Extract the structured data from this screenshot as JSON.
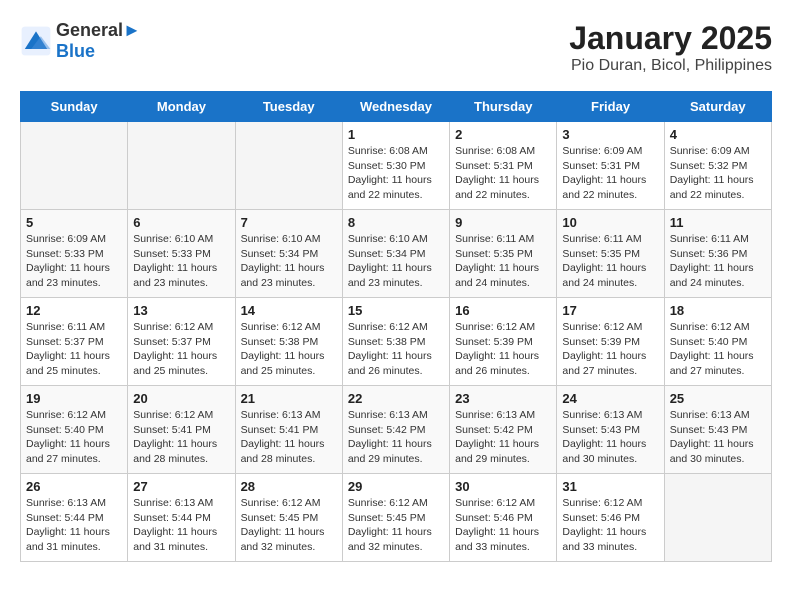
{
  "header": {
    "logo_line1": "General",
    "logo_line2": "Blue",
    "title": "January 2025",
    "subtitle": "Pio Duran, Bicol, Philippines"
  },
  "days_of_week": [
    "Sunday",
    "Monday",
    "Tuesday",
    "Wednesday",
    "Thursday",
    "Friday",
    "Saturday"
  ],
  "weeks": [
    [
      {
        "date": "",
        "info": ""
      },
      {
        "date": "",
        "info": ""
      },
      {
        "date": "",
        "info": ""
      },
      {
        "date": "1",
        "info": "Sunrise: 6:08 AM\nSunset: 5:30 PM\nDaylight: 11 hours and 22 minutes."
      },
      {
        "date": "2",
        "info": "Sunrise: 6:08 AM\nSunset: 5:31 PM\nDaylight: 11 hours and 22 minutes."
      },
      {
        "date": "3",
        "info": "Sunrise: 6:09 AM\nSunset: 5:31 PM\nDaylight: 11 hours and 22 minutes."
      },
      {
        "date": "4",
        "info": "Sunrise: 6:09 AM\nSunset: 5:32 PM\nDaylight: 11 hours and 22 minutes."
      }
    ],
    [
      {
        "date": "5",
        "info": "Sunrise: 6:09 AM\nSunset: 5:33 PM\nDaylight: 11 hours and 23 minutes."
      },
      {
        "date": "6",
        "info": "Sunrise: 6:10 AM\nSunset: 5:33 PM\nDaylight: 11 hours and 23 minutes."
      },
      {
        "date": "7",
        "info": "Sunrise: 6:10 AM\nSunset: 5:34 PM\nDaylight: 11 hours and 23 minutes."
      },
      {
        "date": "8",
        "info": "Sunrise: 6:10 AM\nSunset: 5:34 PM\nDaylight: 11 hours and 23 minutes."
      },
      {
        "date": "9",
        "info": "Sunrise: 6:11 AM\nSunset: 5:35 PM\nDaylight: 11 hours and 24 minutes."
      },
      {
        "date": "10",
        "info": "Sunrise: 6:11 AM\nSunset: 5:35 PM\nDaylight: 11 hours and 24 minutes."
      },
      {
        "date": "11",
        "info": "Sunrise: 6:11 AM\nSunset: 5:36 PM\nDaylight: 11 hours and 24 minutes."
      }
    ],
    [
      {
        "date": "12",
        "info": "Sunrise: 6:11 AM\nSunset: 5:37 PM\nDaylight: 11 hours and 25 minutes."
      },
      {
        "date": "13",
        "info": "Sunrise: 6:12 AM\nSunset: 5:37 PM\nDaylight: 11 hours and 25 minutes."
      },
      {
        "date": "14",
        "info": "Sunrise: 6:12 AM\nSunset: 5:38 PM\nDaylight: 11 hours and 25 minutes."
      },
      {
        "date": "15",
        "info": "Sunrise: 6:12 AM\nSunset: 5:38 PM\nDaylight: 11 hours and 26 minutes."
      },
      {
        "date": "16",
        "info": "Sunrise: 6:12 AM\nSunset: 5:39 PM\nDaylight: 11 hours and 26 minutes."
      },
      {
        "date": "17",
        "info": "Sunrise: 6:12 AM\nSunset: 5:39 PM\nDaylight: 11 hours and 27 minutes."
      },
      {
        "date": "18",
        "info": "Sunrise: 6:12 AM\nSunset: 5:40 PM\nDaylight: 11 hours and 27 minutes."
      }
    ],
    [
      {
        "date": "19",
        "info": "Sunrise: 6:12 AM\nSunset: 5:40 PM\nDaylight: 11 hours and 27 minutes."
      },
      {
        "date": "20",
        "info": "Sunrise: 6:12 AM\nSunset: 5:41 PM\nDaylight: 11 hours and 28 minutes."
      },
      {
        "date": "21",
        "info": "Sunrise: 6:13 AM\nSunset: 5:41 PM\nDaylight: 11 hours and 28 minutes."
      },
      {
        "date": "22",
        "info": "Sunrise: 6:13 AM\nSunset: 5:42 PM\nDaylight: 11 hours and 29 minutes."
      },
      {
        "date": "23",
        "info": "Sunrise: 6:13 AM\nSunset: 5:42 PM\nDaylight: 11 hours and 29 minutes."
      },
      {
        "date": "24",
        "info": "Sunrise: 6:13 AM\nSunset: 5:43 PM\nDaylight: 11 hours and 30 minutes."
      },
      {
        "date": "25",
        "info": "Sunrise: 6:13 AM\nSunset: 5:43 PM\nDaylight: 11 hours and 30 minutes."
      }
    ],
    [
      {
        "date": "26",
        "info": "Sunrise: 6:13 AM\nSunset: 5:44 PM\nDaylight: 11 hours and 31 minutes."
      },
      {
        "date": "27",
        "info": "Sunrise: 6:13 AM\nSunset: 5:44 PM\nDaylight: 11 hours and 31 minutes."
      },
      {
        "date": "28",
        "info": "Sunrise: 6:12 AM\nSunset: 5:45 PM\nDaylight: 11 hours and 32 minutes."
      },
      {
        "date": "29",
        "info": "Sunrise: 6:12 AM\nSunset: 5:45 PM\nDaylight: 11 hours and 32 minutes."
      },
      {
        "date": "30",
        "info": "Sunrise: 6:12 AM\nSunset: 5:46 PM\nDaylight: 11 hours and 33 minutes."
      },
      {
        "date": "31",
        "info": "Sunrise: 6:12 AM\nSunset: 5:46 PM\nDaylight: 11 hours and 33 minutes."
      },
      {
        "date": "",
        "info": ""
      }
    ]
  ]
}
